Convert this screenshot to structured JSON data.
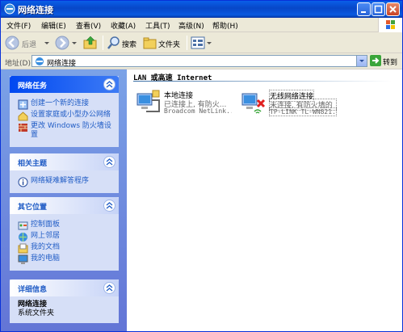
{
  "window": {
    "title": "网络连接"
  },
  "menu": [
    "文件(F)",
    "编辑(E)",
    "查看(V)",
    "收藏(A)",
    "工具(T)",
    "高级(N)",
    "帮助(H)"
  ],
  "toolbar": {
    "back_label": "后退",
    "search_label": "搜索",
    "folders_label": "文件夹"
  },
  "address": {
    "label": "地址(D)",
    "value": "网络连接",
    "go_label": "转到"
  },
  "panels": {
    "tasks": {
      "title": "网络任务",
      "items": [
        "创建一个新的连接",
        "设置家庭或小型办公网络",
        "更改 Windows 防火墙设置"
      ]
    },
    "related": {
      "title": "相关主题",
      "items": [
        "网络疑难解答程序"
      ]
    },
    "places": {
      "title": "其它位置",
      "items": [
        "控制面板",
        "网上邻居",
        "我的文档",
        "我的电脑"
      ]
    },
    "details": {
      "title": "详细信息",
      "name": "网络连接",
      "type": "系统文件夹"
    }
  },
  "main": {
    "group": "LAN 或高速 Internet",
    "connections": [
      {
        "name": "本地连接",
        "status": "已连接上, 有防火...",
        "device": "Broadcom NetLink..."
      },
      {
        "name": "无线网络连接",
        "status": "未连接, 有防火墙的",
        "device": "TP-LINK TL-WN821..."
      }
    ]
  }
}
